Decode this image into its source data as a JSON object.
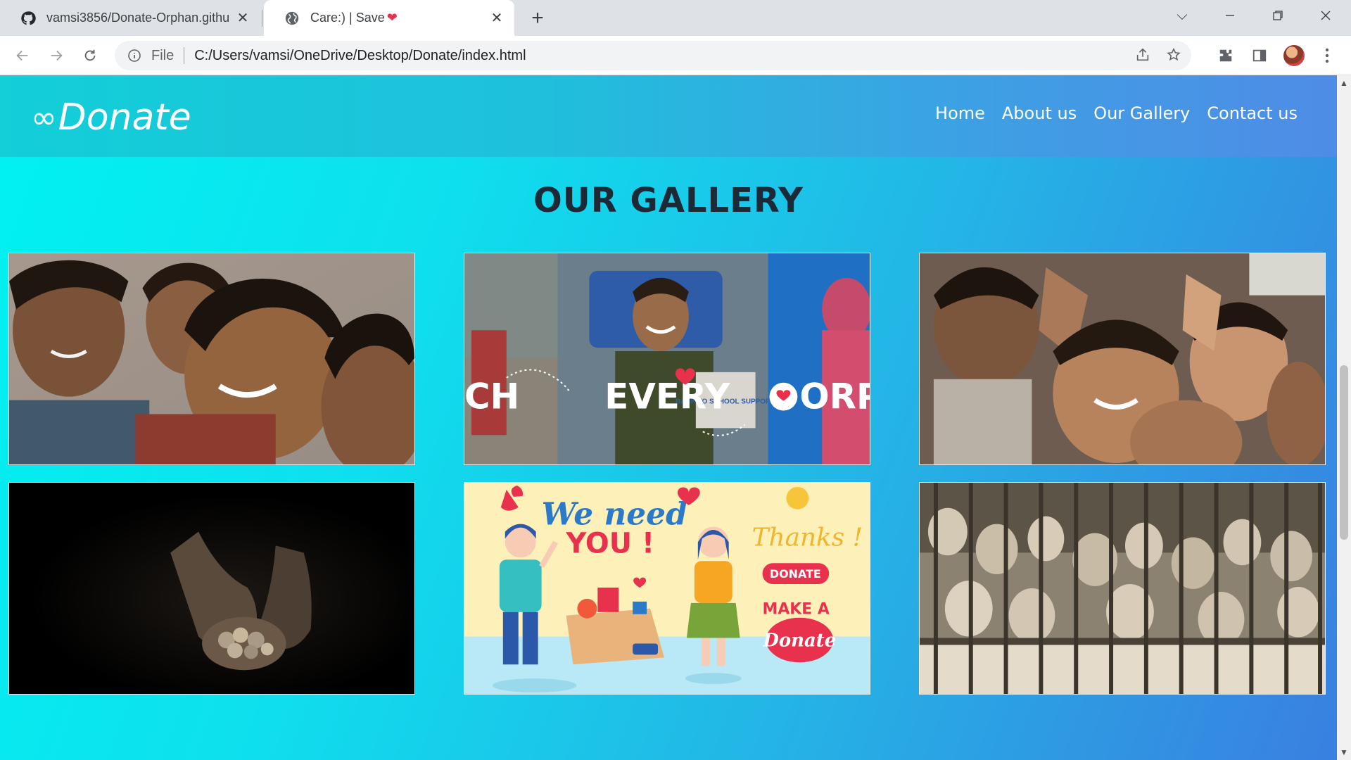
{
  "browser": {
    "tabs": [
      {
        "title": "vamsi3856/Donate-Orphan.githu",
        "icon": "github-icon"
      },
      {
        "title": "Care:) | Save",
        "icon": "globe-icon",
        "active": true
      }
    ],
    "scheme_label": "File",
    "url": "C:/Users/vamsi/OneDrive/Desktop/Donate/index.html"
  },
  "site": {
    "logo": {
      "symbol": "∞",
      "text": "Donate"
    },
    "nav": [
      "Home",
      "About us",
      "Our Gallery",
      "Contact us"
    ]
  },
  "gallery": {
    "title": "OUR GALLERY",
    "images": [
      {
        "subject": "smiling children group"
      },
      {
        "subject": "back to school campaign",
        "text": "EVERY",
        "left_fragment": "CH",
        "right_fragment": "ORP",
        "box_text": "BACK TO SCHOOL SUPPORT"
      },
      {
        "subject": "children waving at camera"
      },
      {
        "subject": "hands holding coins"
      },
      {
        "subject": "we need you illustration",
        "headline_1": "We need",
        "headline_2": "YOU !",
        "thanks": "Thanks !",
        "donate_button": "DONATE",
        "make_a": "MAKE A",
        "donate_script": "Donate"
      },
      {
        "subject": "children behind fence"
      }
    ]
  },
  "colors": {
    "title": "#1b2a36",
    "nav_text": "#ffffff",
    "accent_red": "#e8324d"
  }
}
